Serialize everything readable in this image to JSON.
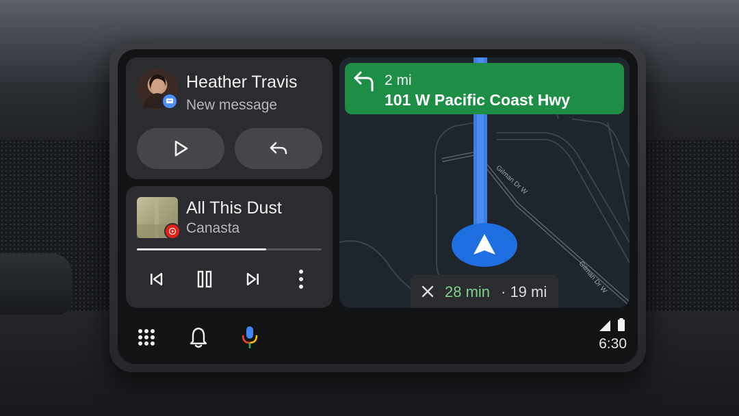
{
  "message_card": {
    "contact_name": "Heather Travis",
    "subtitle": "New message",
    "avatar_icon": "contact-avatar",
    "badge_icon": "messages-app-icon",
    "play_icon": "play-icon",
    "reply_icon": "reply-icon"
  },
  "media_card": {
    "title": "All This Dust",
    "artist": "Canasta",
    "app_badge_icon": "youtube-music-icon",
    "progress_fraction": 0.7,
    "controls": [
      "skip-previous-icon",
      "pause-icon",
      "skip-next-icon",
      "more-vert-icon"
    ]
  },
  "navigation": {
    "distance": "2 mi",
    "street": "101 W Pacific Coast Hwy",
    "turn_icon": "turn-left-icon",
    "road_labels": [
      "Gilman Dr W",
      "Gilman Dr W"
    ],
    "eta_time": "28 min",
    "eta_rest": "· 19 mi",
    "banner_color": "#1e8e46",
    "route_color": "#4285f4"
  },
  "bottom_bar": {
    "apps_icon": "app-grid-icon",
    "notifications_icon": "bell-icon",
    "assistant_icon": "microphone-icon",
    "signal_icon": "signal-icon",
    "battery_icon": "battery-icon",
    "time": "6:30"
  }
}
